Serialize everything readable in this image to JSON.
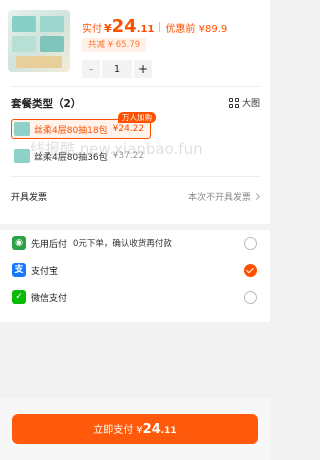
{
  "product": {
    "thumb_icon": "tissue-pack-image",
    "actual_label": "实付",
    "currency": "¥",
    "price_int": "24",
    "price_dec": ".11",
    "pre_price": "优惠前 ¥89.9",
    "discount_tag": "共减 ¥ 65.79",
    "qty_minus": "-",
    "qty": "1",
    "qty_plus": "+"
  },
  "combo": {
    "title": "套餐类型（2）",
    "view_label": "大图",
    "hot_tag": "万人加购",
    "options": [
      {
        "name": "丝柔4层80抽18包",
        "price": "¥24.22",
        "selected": true
      },
      {
        "name": "丝柔4层80抽36包",
        "price": "¥37.22",
        "selected": false
      }
    ]
  },
  "invoice": {
    "label": "开具发票",
    "value": "本次不开具发票"
  },
  "payment": {
    "methods": [
      {
        "icon": "pay-later-icon",
        "icon_glyph": "◉",
        "name": "先用后付",
        "desc": "0元下单，确认收货再付款",
        "selected": false,
        "color": "#2ba245"
      },
      {
        "icon": "alipay-icon",
        "icon_glyph": "支",
        "name": "支付宝",
        "desc": "",
        "selected": true,
        "color": "#1677ff"
      },
      {
        "icon": "wechat-pay-icon",
        "icon_glyph": "✓",
        "name": "微信支付",
        "desc": "",
        "selected": false,
        "color": "#09bb07"
      }
    ]
  },
  "watermark": "线报酷 new.xianbao.fun",
  "footer": {
    "pay_label": "立即支付",
    "currency": "¥",
    "price_int": "24",
    "price_dec": ".11"
  },
  "colors": {
    "accent": "#ff5000",
    "page_bg": "#f2f2f2"
  }
}
